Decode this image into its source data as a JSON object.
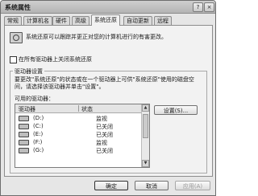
{
  "window": {
    "title": "系统属性",
    "help_label": "?",
    "close_label": "×"
  },
  "tabs": [
    {
      "label": "常规"
    },
    {
      "label": "计算机名"
    },
    {
      "label": "硬件"
    },
    {
      "label": "高级"
    },
    {
      "label": "系统还原",
      "active": true
    },
    {
      "label": "自动更新"
    },
    {
      "label": "远程"
    }
  ],
  "panel": {
    "description": "系统还原可以跟踪并更正对您的计算机进行的有害更改。",
    "disable_all": {
      "label": "在所有驱动器上关闭系统还原",
      "checked": false
    },
    "group": {
      "title": "驱动器设置",
      "description": "要更改\"系统还原\"的状态或在一个驱动器上可供\"系统还原\"使用的磁盘空间，请选择该驱动器并单击\"设置\"。",
      "available_label": "可用的驱动器：",
      "columns": [
        "驱动器",
        "状态"
      ],
      "drives": [
        {
          "name": "(D:)",
          "status": "监视"
        },
        {
          "name": "(C:)",
          "status": "已关闭"
        },
        {
          "name": "(E:)",
          "status": "已关闭"
        },
        {
          "name": "(F:)",
          "status": "监视"
        },
        {
          "name": "(G:)",
          "status": "已关闭"
        }
      ],
      "settings_label": "设置(S)..."
    }
  },
  "footer": {
    "ok_label": "确定",
    "cancel_label": "取消",
    "apply_label": "应用(A)"
  }
}
